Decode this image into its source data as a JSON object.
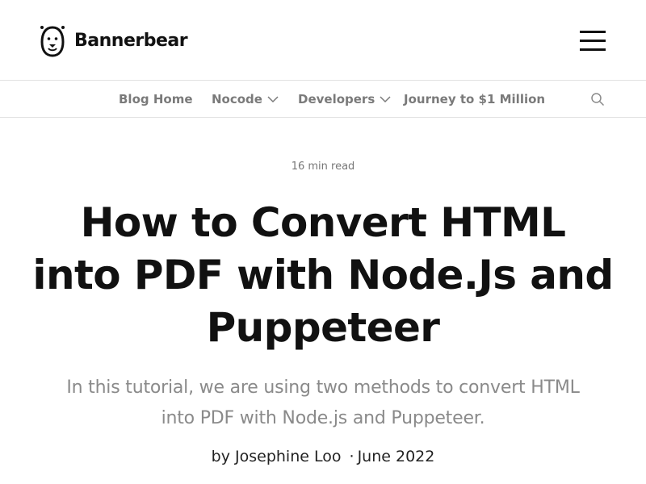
{
  "brand": {
    "name": "Bannerbear",
    "logo_icon": "bear-face-icon"
  },
  "header": {
    "menu_icon": "hamburger-menu-icon"
  },
  "nav": {
    "items": [
      {
        "label": "Blog Home",
        "has_dropdown": false
      },
      {
        "label": "Nocode",
        "has_dropdown": true
      },
      {
        "label": "Developers",
        "has_dropdown": true
      },
      {
        "label": "Journey to $1 Million",
        "has_dropdown": false
      }
    ],
    "search_icon": "search-icon"
  },
  "article": {
    "read_time": "16 min read",
    "title": "How to Convert HTML into PDF with Node.Js and Puppeteer",
    "subtitle": "In this tutorial, we are using two methods to convert HTML into PDF with Node.js and Puppeteer.",
    "byline_prefix": "by",
    "author": "Josephine Loo",
    "separator": "·",
    "date": "June 2022"
  },
  "colors": {
    "text": "#111111",
    "muted": "#7a7a7a",
    "divider": "#e2e2e2"
  }
}
